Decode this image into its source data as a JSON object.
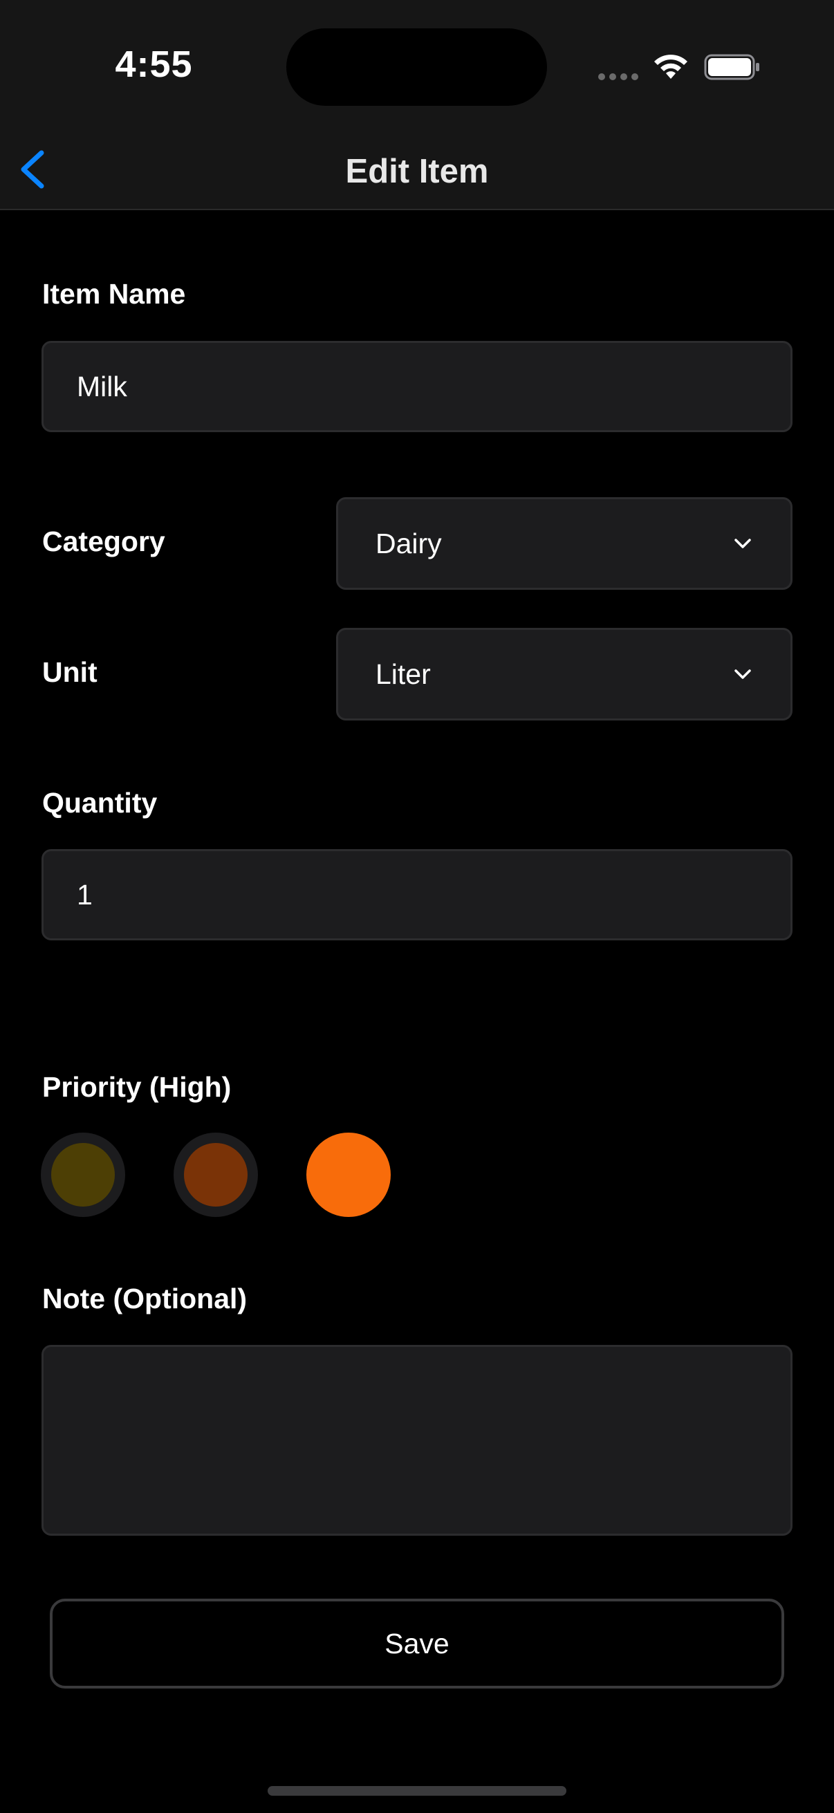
{
  "status_bar": {
    "time": "4:55",
    "icons": [
      "signal-dots-icon",
      "wifi-icon",
      "battery-icon"
    ]
  },
  "nav": {
    "title": "Edit Item",
    "back_icon": "chevron-left-icon"
  },
  "form": {
    "item_name": {
      "label": "Item Name",
      "value": "Milk"
    },
    "category": {
      "label": "Category",
      "selected": "Dairy"
    },
    "unit": {
      "label": "Unit",
      "selected": "Liter"
    },
    "quantity": {
      "label": "Quantity",
      "value": "1"
    },
    "priority": {
      "label": "Priority (High)",
      "options": [
        {
          "level": "low",
          "color": "#4d3f05",
          "selected": false
        },
        {
          "level": "medium",
          "color": "#7a3307",
          "selected": false
        },
        {
          "level": "high",
          "color": "#f86c0b",
          "selected": true
        }
      ]
    },
    "note": {
      "label": "Note (Optional)",
      "value": ""
    },
    "save_label": "Save"
  },
  "colors": {
    "accent": "#0a84ff",
    "background": "#000000",
    "bar_background": "#161616",
    "field_background": "#1c1c1e",
    "field_border": "#2c2c2e"
  }
}
